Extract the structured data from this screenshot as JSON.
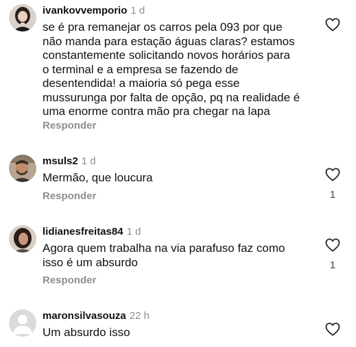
{
  "comments": [
    {
      "username": "ivankovvemporio",
      "time": "1 d",
      "lines": [
        "se é pra remanejar os carros pela 093 por que",
        "não manda para estação águas claras? estamos",
        "constantemente solicitando novos horários para",
        "o terminal e a empresa se fazendo de",
        "desentendida! a maioria só pega esse",
        "mussurunga por falta de opção, pq na realidade é",
        "uma enorme contra mão pra chegar na lapa"
      ],
      "reply_label": "Responder",
      "likes": "",
      "avatar_icon": "user-photo-avatar"
    },
    {
      "username": "msuls2",
      "time": "1 d",
      "lines": [
        "Mermão, que loucura"
      ],
      "reply_label": "Responder",
      "likes": "1",
      "avatar_icon": "user-photo-avatar"
    },
    {
      "username": "lidianesfreitas84",
      "time": "1 d",
      "lines": [
        "Agora quem trabalha na via parafuso faz como",
        "isso é um absurdo"
      ],
      "reply_label": "Responder",
      "likes": "1",
      "avatar_icon": "user-photo-avatar"
    },
    {
      "username": "maronsilvasouza",
      "time": "22 h",
      "lines": [
        "Um absurdo isso"
      ],
      "reply_label": "",
      "likes": "",
      "avatar_icon": "default-user-avatar"
    }
  ],
  "icons": {
    "like": "heart-outline-icon"
  },
  "colors": {
    "text": "#111111",
    "muted": "#8e8e8e",
    "background": "#ffffff"
  }
}
